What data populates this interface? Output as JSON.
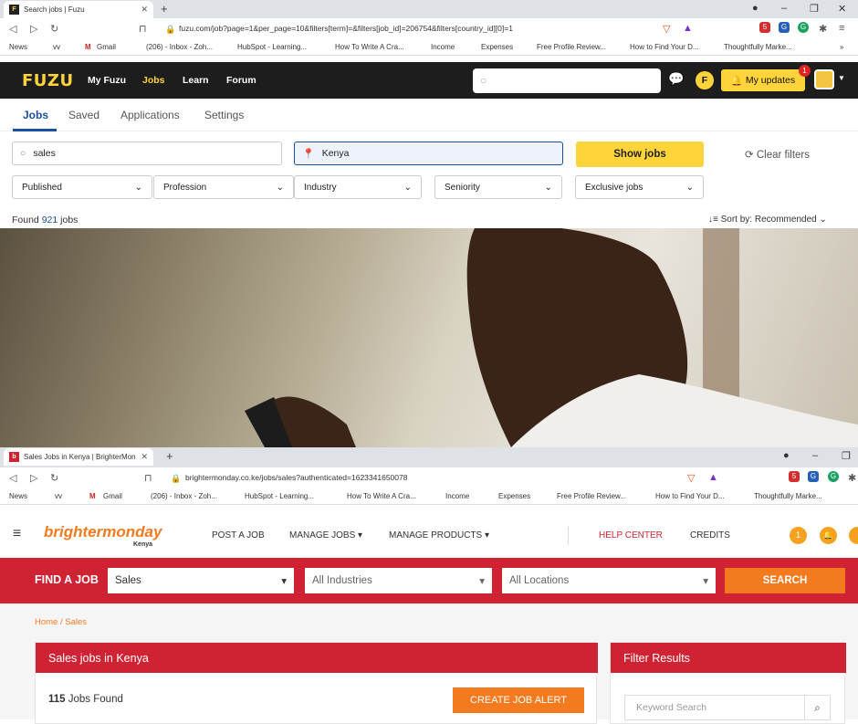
{
  "window1": {
    "tab_title": "Search jobs | Fuzu",
    "url": "fuzu.com/job?page=1&per_page=10&filters[term]=&filters[job_id]=206754&filters[country_id][0]=1",
    "bookmarks": [
      "News",
      "vv",
      "Gmail",
      "(206) - Inbox - Zoh...",
      "HubSpot - Learning...",
      "How To Write A Cra...",
      "Income",
      "Expenses",
      "Free Profile Review...",
      "How to Find Your D...",
      "Thoughtfully Marke..."
    ],
    "bookmarks_more": "»"
  },
  "fuzu": {
    "logo": "FUZU",
    "nav": [
      "My Fuzu",
      "Jobs",
      "Learn",
      "Forum"
    ],
    "updates_label": "My updates",
    "updates_badge": "1",
    "tabs": [
      "Jobs",
      "Saved",
      "Applications",
      "Settings"
    ],
    "search_value": "sales",
    "location_value": "Kenya",
    "show_jobs": "Show jobs",
    "clear_filters": "Clear filters",
    "filters": [
      "Published",
      "Profession",
      "Industry",
      "Seniority",
      "Exclusive jobs"
    ],
    "found_prefix": "Found",
    "found_count": "921",
    "found_suffix": "jobs",
    "sort_label": "Sort by:",
    "sort_value": "Recommended"
  },
  "window2": {
    "tab_title": "Sales Jobs in Kenya | BrighterMon",
    "url": "brightermonday.co.ke/jobs/sales?authenticated=1623341650078",
    "bookmarks": [
      "News",
      "vv",
      "Gmail",
      "(206) - Inbox - Zoh...",
      "HubSpot - Learning...",
      "How To Write A Cra...",
      "Income",
      "Expenses",
      "Free Profile Review...",
      "How to Find Your D...",
      "Thoughtfully Marke..."
    ]
  },
  "brightermonday": {
    "logo": "brightermonday",
    "logo_sub": "Kenya",
    "nav": [
      "POST A JOB",
      "MANAGE JOBS",
      "MANAGE PRODUCTS",
      "HELP CENTER",
      "CREDITS"
    ],
    "notif_count": "1",
    "find_label": "FIND A JOB",
    "select_job": "Sales",
    "select_industry": "All Industries",
    "select_location": "All Locations",
    "search_button": "SEARCH",
    "breadcrumb": "Home / Sales",
    "results_title": "Sales jobs in Kenya",
    "jobs_count": "115",
    "jobs_found_label": "Jobs Found",
    "create_alert": "CREATE JOB ALERT",
    "filter_title": "Filter Results",
    "keyword_placeholder": "Keyword Search"
  },
  "colors": {
    "fuzu_yellow": "#ffd43b",
    "fuzu_dark": "#1d1d1d",
    "bm_red": "#cf2233",
    "bm_orange": "#f47a1f",
    "fuzu_blue": "#1a4fa3"
  }
}
